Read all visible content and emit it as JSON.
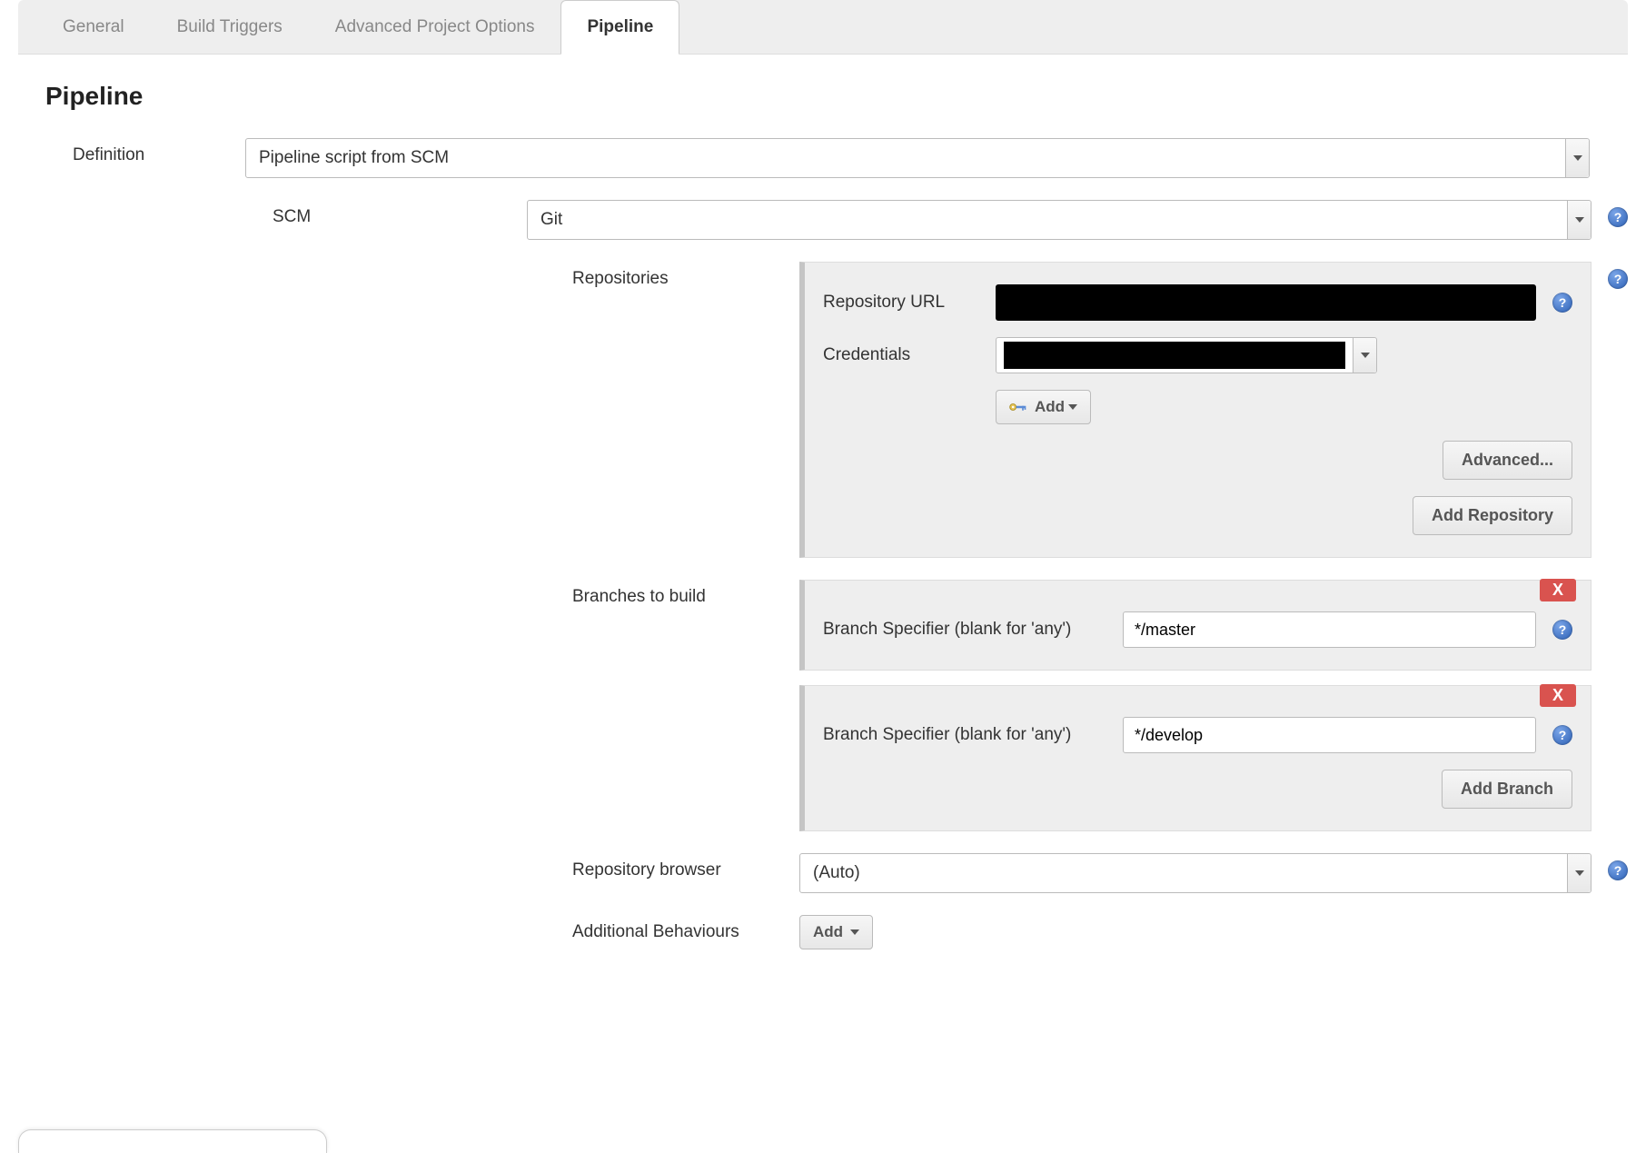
{
  "tabs": {
    "general": "General",
    "build_triggers": "Build Triggers",
    "advanced": "Advanced Project Options",
    "pipeline": "Pipeline"
  },
  "section_title": "Pipeline",
  "definition": {
    "label": "Definition",
    "value": "Pipeline script from SCM"
  },
  "scm": {
    "label": "SCM",
    "value": "Git"
  },
  "repositories": {
    "label": "Repositories",
    "url_label": "Repository URL",
    "credentials_label": "Credentials",
    "add_button": "Add",
    "advanced_button": "Advanced...",
    "add_repo_button": "Add Repository"
  },
  "branches": {
    "label": "Branches to build",
    "specifier_label": "Branch Specifier (blank for 'any')",
    "items": [
      {
        "value": "*/master"
      },
      {
        "value": "*/develop"
      }
    ],
    "delete_label": "X",
    "add_branch_button": "Add Branch"
  },
  "repo_browser": {
    "label": "Repository browser",
    "value": "(Auto)"
  },
  "additional": {
    "label": "Additional Behaviours",
    "add_button": "Add"
  },
  "help_glyph": "?"
}
